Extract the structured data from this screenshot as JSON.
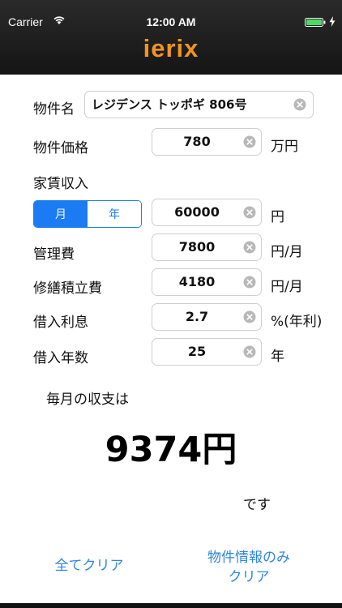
{
  "status_bar": {
    "carrier": "Carrier",
    "time": "12:00 AM",
    "wifi_icon": "wifi-icon",
    "battery_icon": "battery-icon",
    "charging_icon": "bolt-icon",
    "battery_color": "#4cd964"
  },
  "app": {
    "title": "ierix",
    "accent_color": "#f29422"
  },
  "property": {
    "name_label": "物件名",
    "name_value": "レジデンス トッポギ 806号",
    "price_label": "物件価格",
    "price_value": "780",
    "price_unit": "万円"
  },
  "rent": {
    "label": "家賃収入",
    "segments": [
      "月",
      "年"
    ],
    "selected_segment": "月",
    "value": "60000",
    "unit": "円"
  },
  "management": {
    "label": "管理費",
    "value": "7800",
    "unit": "円/月"
  },
  "repair": {
    "label": "修繕積立費",
    "value": "4180",
    "unit": "円/月"
  },
  "interest": {
    "label": "借入利息",
    "value": "2.7",
    "unit": "%(年利)"
  },
  "loan_years": {
    "label": "借入年数",
    "value": "25",
    "unit": "年"
  },
  "result": {
    "caption": "毎月の収支は",
    "value": "9374円",
    "suffix": "です"
  },
  "actions": {
    "clear_all": "全てクリア",
    "clear_property_line1": "物件情報のみ",
    "clear_property_line2": "クリア",
    "link_color": "#2f86e0"
  }
}
